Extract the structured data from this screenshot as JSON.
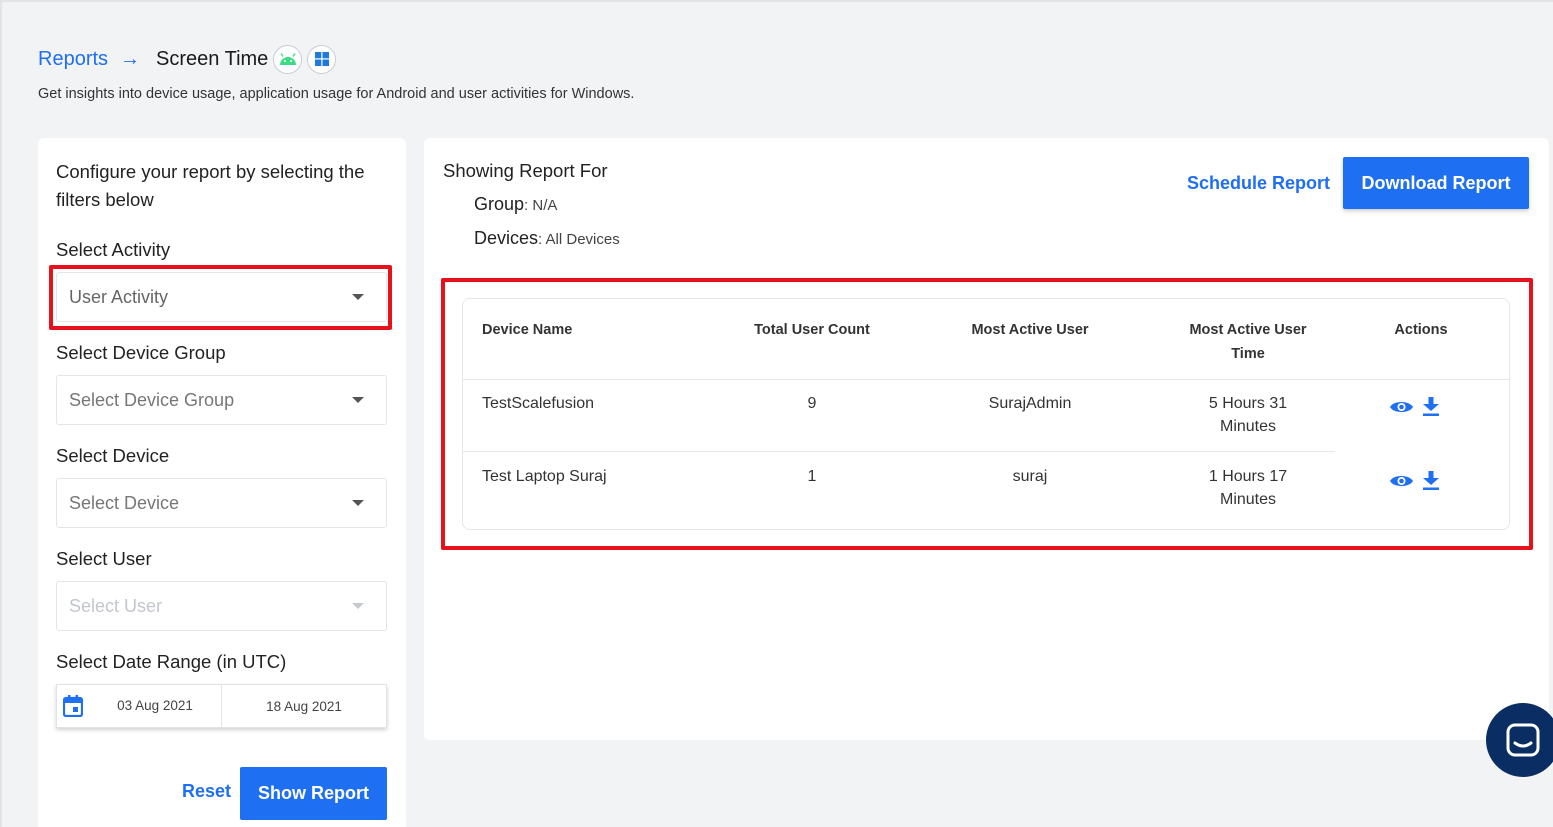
{
  "header": {
    "breadcrumb_root": "Reports",
    "breadcrumb_arrow": "→",
    "breadcrumb_current": "Screen Time",
    "subtitle": "Get insights into device usage, application usage for Android and user activities for Windows."
  },
  "filters": {
    "intro": "Configure your report by selecting the filters below",
    "activity_label": "Select Activity",
    "activity_value": "User Activity",
    "group_label": "Select Device Group",
    "group_placeholder": "Select Device Group",
    "device_label": "Select Device",
    "device_placeholder": "Select Device",
    "user_label": "Select User",
    "user_placeholder": "Select User",
    "date_label": "Select Date Range (in UTC)",
    "date_from": "03 Aug 2021",
    "date_to": "18 Aug 2021",
    "reset_label": "Reset",
    "show_label": "Show Report"
  },
  "report": {
    "title": "Showing Report For",
    "group_key": "Group",
    "group_value": ": N/A",
    "devices_key": "Devices",
    "devices_value": ": All Devices",
    "schedule_label": "Schedule Report",
    "download_label": "Download Report"
  },
  "table": {
    "headers": [
      "Device Name",
      "Total User Count",
      "Most Active User",
      "Most Active User Time",
      "Actions"
    ],
    "rows": [
      {
        "device": "TestScalefusion",
        "count": "9",
        "user": "SurajAdmin",
        "time": "5 Hours 31 Minutes"
      },
      {
        "device": "Test Laptop Suraj",
        "count": "1",
        "user": "suraj",
        "time": "1 Hours 17 Minutes"
      }
    ]
  },
  "colors": {
    "accent": "#1f6ff2",
    "highlight": "#e8111b",
    "chat": "#0a2e63"
  }
}
